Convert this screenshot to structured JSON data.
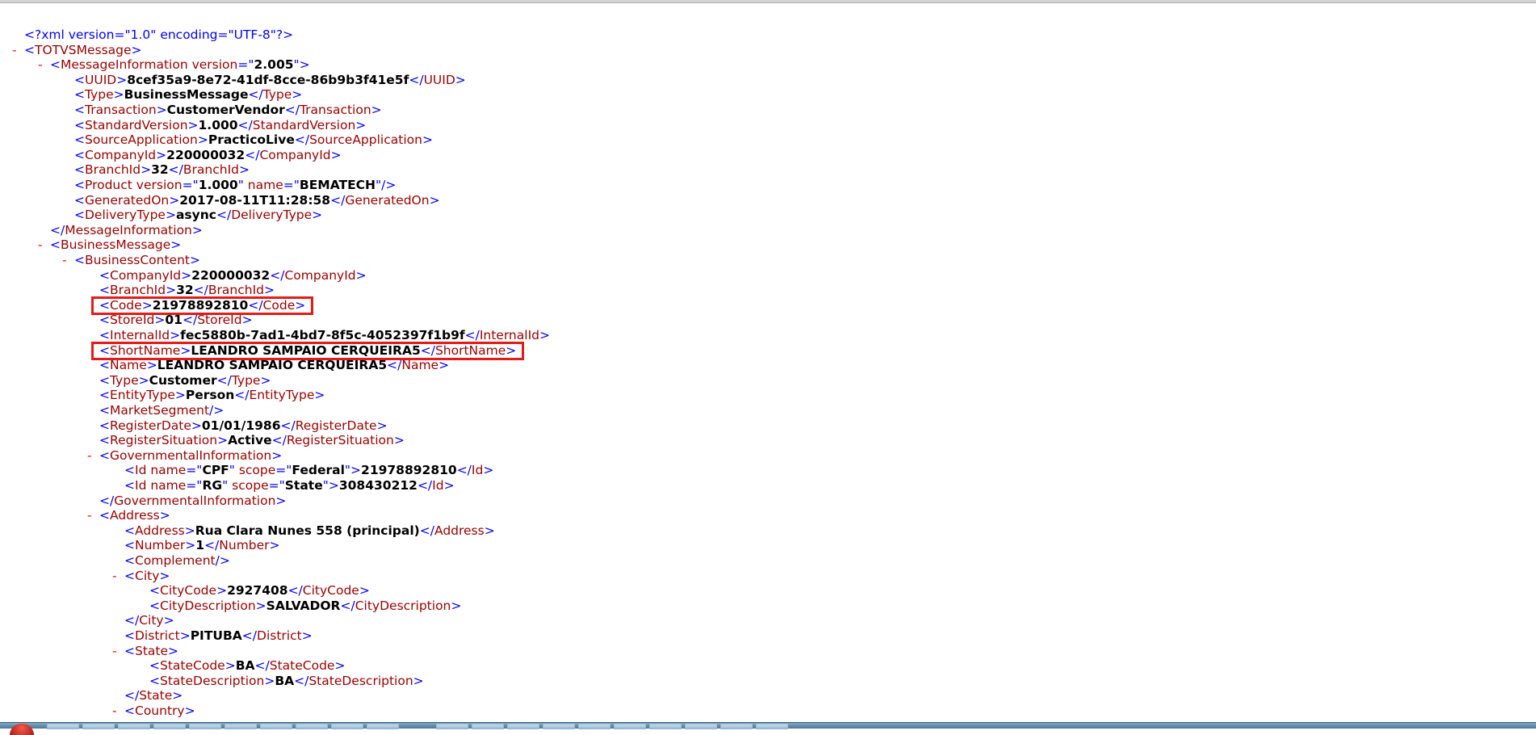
{
  "prolog": "<?xml version=\"1.0\" encoding=\"UTF-8\"?>",
  "toggle_symbol": "-",
  "xml_lines": [
    {
      "indent": 1,
      "toggle": false,
      "parts": [
        [
          "tg",
          "<?xml version=\"1.0\" encoding=\"UTF-8\"?>"
        ]
      ]
    },
    {
      "indent": 1,
      "toggle": true,
      "parts": [
        [
          "tg",
          "<"
        ],
        [
          "tn",
          "TOTVSMessage"
        ],
        [
          "tg",
          ">"
        ]
      ]
    },
    {
      "indent": 2,
      "toggle": true,
      "parts": [
        [
          "tg",
          "<"
        ],
        [
          "tn",
          "MessageInformation"
        ],
        [
          "an",
          " version"
        ],
        [
          "tg",
          "=\""
        ],
        [
          "av",
          "2.005"
        ],
        [
          "tg",
          "\">"
        ]
      ]
    },
    {
      "indent": 3,
      "toggle": false,
      "parts": [
        [
          "tg",
          "<"
        ],
        [
          "tn",
          "UUID"
        ],
        [
          "tg",
          ">"
        ],
        [
          "tx",
          "8cef35a9-8e72-41df-8cce-86b9b3f41e5f"
        ],
        [
          "tg",
          "</"
        ],
        [
          "tn",
          "UUID"
        ],
        [
          "tg",
          ">"
        ]
      ]
    },
    {
      "indent": 3,
      "toggle": false,
      "parts": [
        [
          "tg",
          "<"
        ],
        [
          "tn",
          "Type"
        ],
        [
          "tg",
          ">"
        ],
        [
          "tx",
          "BusinessMessage"
        ],
        [
          "tg",
          "</"
        ],
        [
          "tn",
          "Type"
        ],
        [
          "tg",
          ">"
        ]
      ]
    },
    {
      "indent": 3,
      "toggle": false,
      "parts": [
        [
          "tg",
          "<"
        ],
        [
          "tn",
          "Transaction"
        ],
        [
          "tg",
          ">"
        ],
        [
          "tx",
          "CustomerVendor"
        ],
        [
          "tg",
          "</"
        ],
        [
          "tn",
          "Transaction"
        ],
        [
          "tg",
          ">"
        ]
      ]
    },
    {
      "indent": 3,
      "toggle": false,
      "parts": [
        [
          "tg",
          "<"
        ],
        [
          "tn",
          "StandardVersion"
        ],
        [
          "tg",
          ">"
        ],
        [
          "tx",
          "1.000"
        ],
        [
          "tg",
          "</"
        ],
        [
          "tn",
          "StandardVersion"
        ],
        [
          "tg",
          ">"
        ]
      ]
    },
    {
      "indent": 3,
      "toggle": false,
      "parts": [
        [
          "tg",
          "<"
        ],
        [
          "tn",
          "SourceApplication"
        ],
        [
          "tg",
          ">"
        ],
        [
          "tx",
          "PracticoLive"
        ],
        [
          "tg",
          "</"
        ],
        [
          "tn",
          "SourceApplication"
        ],
        [
          "tg",
          ">"
        ]
      ]
    },
    {
      "indent": 3,
      "toggle": false,
      "parts": [
        [
          "tg",
          "<"
        ],
        [
          "tn",
          "CompanyId"
        ],
        [
          "tg",
          ">"
        ],
        [
          "tx",
          "220000032"
        ],
        [
          "tg",
          "</"
        ],
        [
          "tn",
          "CompanyId"
        ],
        [
          "tg",
          ">"
        ]
      ]
    },
    {
      "indent": 3,
      "toggle": false,
      "parts": [
        [
          "tg",
          "<"
        ],
        [
          "tn",
          "BranchId"
        ],
        [
          "tg",
          ">"
        ],
        [
          "tx",
          "32"
        ],
        [
          "tg",
          "</"
        ],
        [
          "tn",
          "BranchId"
        ],
        [
          "tg",
          ">"
        ]
      ]
    },
    {
      "indent": 3,
      "toggle": false,
      "parts": [
        [
          "tg",
          "<"
        ],
        [
          "tn",
          "Product"
        ],
        [
          "an",
          " version"
        ],
        [
          "tg",
          "=\""
        ],
        [
          "av",
          "1.000"
        ],
        [
          "tg",
          "\""
        ],
        [
          "an",
          " name"
        ],
        [
          "tg",
          "=\""
        ],
        [
          "av",
          "BEMATECH"
        ],
        [
          "tg",
          "\"/>"
        ]
      ]
    },
    {
      "indent": 3,
      "toggle": false,
      "parts": [
        [
          "tg",
          "<"
        ],
        [
          "tn",
          "GeneratedOn"
        ],
        [
          "tg",
          ">"
        ],
        [
          "tx",
          "2017-08-11T11:28:58"
        ],
        [
          "tg",
          "</"
        ],
        [
          "tn",
          "GeneratedOn"
        ],
        [
          "tg",
          ">"
        ]
      ]
    },
    {
      "indent": 3,
      "toggle": false,
      "parts": [
        [
          "tg",
          "<"
        ],
        [
          "tn",
          "DeliveryType"
        ],
        [
          "tg",
          ">"
        ],
        [
          "tx",
          "async"
        ],
        [
          "tg",
          "</"
        ],
        [
          "tn",
          "DeliveryType"
        ],
        [
          "tg",
          ">"
        ]
      ]
    },
    {
      "indent": 2,
      "toggle": false,
      "parts": [
        [
          "tg",
          "</"
        ],
        [
          "tn",
          "MessageInformation"
        ],
        [
          "tg",
          ">"
        ]
      ]
    },
    {
      "indent": 2,
      "toggle": true,
      "parts": [
        [
          "tg",
          "<"
        ],
        [
          "tn",
          "BusinessMessage"
        ],
        [
          "tg",
          ">"
        ]
      ]
    },
    {
      "indent": 3,
      "toggle": true,
      "parts": [
        [
          "tg",
          "<"
        ],
        [
          "tn",
          "BusinessContent"
        ],
        [
          "tg",
          ">"
        ]
      ]
    },
    {
      "indent": 4,
      "toggle": false,
      "parts": [
        [
          "tg",
          "<"
        ],
        [
          "tn",
          "CompanyId"
        ],
        [
          "tg",
          ">"
        ],
        [
          "tx",
          "220000032"
        ],
        [
          "tg",
          "</"
        ],
        [
          "tn",
          "CompanyId"
        ],
        [
          "tg",
          ">"
        ]
      ]
    },
    {
      "indent": 4,
      "toggle": false,
      "parts": [
        [
          "tg",
          "<"
        ],
        [
          "tn",
          "BranchId"
        ],
        [
          "tg",
          ">"
        ],
        [
          "tx",
          "32"
        ],
        [
          "tg",
          "</"
        ],
        [
          "tn",
          "BranchId"
        ],
        [
          "tg",
          ">"
        ]
      ]
    },
    {
      "indent": 4,
      "toggle": false,
      "parts": [
        [
          "tg",
          "<"
        ],
        [
          "tn",
          "Code"
        ],
        [
          "tg",
          ">"
        ],
        [
          "tx",
          "21978892810"
        ],
        [
          "tg",
          "</"
        ],
        [
          "tn",
          "Code"
        ],
        [
          "tg",
          ">"
        ]
      ]
    },
    {
      "indent": 4,
      "toggle": false,
      "parts": [
        [
          "tg",
          "<"
        ],
        [
          "tn",
          "StoreId"
        ],
        [
          "tg",
          ">"
        ],
        [
          "tx",
          "01"
        ],
        [
          "tg",
          "</"
        ],
        [
          "tn",
          "StoreId"
        ],
        [
          "tg",
          ">"
        ]
      ]
    },
    {
      "indent": 4,
      "toggle": false,
      "parts": [
        [
          "tg",
          "<"
        ],
        [
          "tn",
          "InternalId"
        ],
        [
          "tg",
          ">"
        ],
        [
          "tx",
          "fec5880b-7ad1-4bd7-8f5c-4052397f1b9f"
        ],
        [
          "tg",
          "</"
        ],
        [
          "tn",
          "InternalId"
        ],
        [
          "tg",
          ">"
        ]
      ]
    },
    {
      "indent": 4,
      "toggle": false,
      "parts": [
        [
          "tg",
          "<"
        ],
        [
          "tn",
          "ShortName"
        ],
        [
          "tg",
          ">"
        ],
        [
          "tx",
          "LEANDRO SAMPAIO CERQUEIRA5"
        ],
        [
          "tg",
          "</"
        ],
        [
          "tn",
          "ShortName"
        ],
        [
          "tg",
          ">"
        ]
      ]
    },
    {
      "indent": 4,
      "toggle": false,
      "parts": [
        [
          "tg",
          "<"
        ],
        [
          "tn",
          "Name"
        ],
        [
          "tg",
          ">"
        ],
        [
          "tx",
          "LEANDRO SAMPAIO CERQUEIRA5"
        ],
        [
          "tg",
          "</"
        ],
        [
          "tn",
          "Name"
        ],
        [
          "tg",
          ">"
        ]
      ]
    },
    {
      "indent": 4,
      "toggle": false,
      "parts": [
        [
          "tg",
          "<"
        ],
        [
          "tn",
          "Type"
        ],
        [
          "tg",
          ">"
        ],
        [
          "tx",
          "Customer"
        ],
        [
          "tg",
          "</"
        ],
        [
          "tn",
          "Type"
        ],
        [
          "tg",
          ">"
        ]
      ]
    },
    {
      "indent": 4,
      "toggle": false,
      "parts": [
        [
          "tg",
          "<"
        ],
        [
          "tn",
          "EntityType"
        ],
        [
          "tg",
          ">"
        ],
        [
          "tx",
          "Person"
        ],
        [
          "tg",
          "</"
        ],
        [
          "tn",
          "EntityType"
        ],
        [
          "tg",
          ">"
        ]
      ]
    },
    {
      "indent": 4,
      "toggle": false,
      "parts": [
        [
          "tg",
          "<"
        ],
        [
          "tn",
          "MarketSegment"
        ],
        [
          "tg",
          "/>"
        ]
      ]
    },
    {
      "indent": 4,
      "toggle": false,
      "parts": [
        [
          "tg",
          "<"
        ],
        [
          "tn",
          "RegisterDate"
        ],
        [
          "tg",
          ">"
        ],
        [
          "tx",
          "01/01/1986"
        ],
        [
          "tg",
          "</"
        ],
        [
          "tn",
          "RegisterDate"
        ],
        [
          "tg",
          ">"
        ]
      ]
    },
    {
      "indent": 4,
      "toggle": false,
      "parts": [
        [
          "tg",
          "<"
        ],
        [
          "tn",
          "RegisterSituation"
        ],
        [
          "tg",
          ">"
        ],
        [
          "tx",
          "Active"
        ],
        [
          "tg",
          "</"
        ],
        [
          "tn",
          "RegisterSituation"
        ],
        [
          "tg",
          ">"
        ]
      ]
    },
    {
      "indent": 4,
      "toggle": true,
      "parts": [
        [
          "tg",
          "<"
        ],
        [
          "tn",
          "GovernmentalInformation"
        ],
        [
          "tg",
          ">"
        ]
      ]
    },
    {
      "indent": 5,
      "toggle": false,
      "parts": [
        [
          "tg",
          "<"
        ],
        [
          "tn",
          "Id"
        ],
        [
          "an",
          " name"
        ],
        [
          "tg",
          "=\""
        ],
        [
          "av",
          "CPF"
        ],
        [
          "tg",
          "\""
        ],
        [
          "an",
          " scope"
        ],
        [
          "tg",
          "=\""
        ],
        [
          "av",
          "Federal"
        ],
        [
          "tg",
          "\">"
        ],
        [
          "tx",
          "21978892810"
        ],
        [
          "tg",
          "</"
        ],
        [
          "tn",
          "Id"
        ],
        [
          "tg",
          ">"
        ]
      ]
    },
    {
      "indent": 5,
      "toggle": false,
      "parts": [
        [
          "tg",
          "<"
        ],
        [
          "tn",
          "Id"
        ],
        [
          "an",
          " name"
        ],
        [
          "tg",
          "=\""
        ],
        [
          "av",
          "RG"
        ],
        [
          "tg",
          "\""
        ],
        [
          "an",
          " scope"
        ],
        [
          "tg",
          "=\""
        ],
        [
          "av",
          "State"
        ],
        [
          "tg",
          "\">"
        ],
        [
          "tx",
          "308430212"
        ],
        [
          "tg",
          "</"
        ],
        [
          "tn",
          "Id"
        ],
        [
          "tg",
          ">"
        ]
      ]
    },
    {
      "indent": 4,
      "toggle": false,
      "parts": [
        [
          "tg",
          "</"
        ],
        [
          "tn",
          "GovernmentalInformation"
        ],
        [
          "tg",
          ">"
        ]
      ]
    },
    {
      "indent": 4,
      "toggle": true,
      "parts": [
        [
          "tg",
          "<"
        ],
        [
          "tn",
          "Address"
        ],
        [
          "tg",
          ">"
        ]
      ]
    },
    {
      "indent": 5,
      "toggle": false,
      "parts": [
        [
          "tg",
          "<"
        ],
        [
          "tn",
          "Address"
        ],
        [
          "tg",
          ">"
        ],
        [
          "tx",
          "Rua Clara Nunes 558 (principal)"
        ],
        [
          "tg",
          "</"
        ],
        [
          "tn",
          "Address"
        ],
        [
          "tg",
          ">"
        ]
      ]
    },
    {
      "indent": 5,
      "toggle": false,
      "parts": [
        [
          "tg",
          "<"
        ],
        [
          "tn",
          "Number"
        ],
        [
          "tg",
          ">"
        ],
        [
          "tx",
          "1"
        ],
        [
          "tg",
          "</"
        ],
        [
          "tn",
          "Number"
        ],
        [
          "tg",
          ">"
        ]
      ]
    },
    {
      "indent": 5,
      "toggle": false,
      "parts": [
        [
          "tg",
          "<"
        ],
        [
          "tn",
          "Complement"
        ],
        [
          "tg",
          "/>"
        ]
      ]
    },
    {
      "indent": 5,
      "toggle": true,
      "parts": [
        [
          "tg",
          "<"
        ],
        [
          "tn",
          "City"
        ],
        [
          "tg",
          ">"
        ]
      ]
    },
    {
      "indent": 6,
      "toggle": false,
      "parts": [
        [
          "tg",
          "<"
        ],
        [
          "tn",
          "CityCode"
        ],
        [
          "tg",
          ">"
        ],
        [
          "tx",
          "2927408"
        ],
        [
          "tg",
          "</"
        ],
        [
          "tn",
          "CityCode"
        ],
        [
          "tg",
          ">"
        ]
      ]
    },
    {
      "indent": 6,
      "toggle": false,
      "parts": [
        [
          "tg",
          "<"
        ],
        [
          "tn",
          "CityDescription"
        ],
        [
          "tg",
          ">"
        ],
        [
          "tx",
          "SALVADOR"
        ],
        [
          "tg",
          "</"
        ],
        [
          "tn",
          "CityDescription"
        ],
        [
          "tg",
          ">"
        ]
      ]
    },
    {
      "indent": 5,
      "toggle": false,
      "parts": [
        [
          "tg",
          "</"
        ],
        [
          "tn",
          "City"
        ],
        [
          "tg",
          ">"
        ]
      ]
    },
    {
      "indent": 5,
      "toggle": false,
      "parts": [
        [
          "tg",
          "<"
        ],
        [
          "tn",
          "District"
        ],
        [
          "tg",
          ">"
        ],
        [
          "tx",
          "PITUBA"
        ],
        [
          "tg",
          "</"
        ],
        [
          "tn",
          "District"
        ],
        [
          "tg",
          ">"
        ]
      ]
    },
    {
      "indent": 5,
      "toggle": true,
      "parts": [
        [
          "tg",
          "<"
        ],
        [
          "tn",
          "State"
        ],
        [
          "tg",
          ">"
        ]
      ]
    },
    {
      "indent": 6,
      "toggle": false,
      "parts": [
        [
          "tg",
          "<"
        ],
        [
          "tn",
          "StateCode"
        ],
        [
          "tg",
          ">"
        ],
        [
          "tx",
          "BA"
        ],
        [
          "tg",
          "</"
        ],
        [
          "tn",
          "StateCode"
        ],
        [
          "tg",
          ">"
        ]
      ]
    },
    {
      "indent": 6,
      "toggle": false,
      "parts": [
        [
          "tg",
          "<"
        ],
        [
          "tn",
          "StateDescription"
        ],
        [
          "tg",
          ">"
        ],
        [
          "tx",
          "BA"
        ],
        [
          "tg",
          "</"
        ],
        [
          "tn",
          "StateDescription"
        ],
        [
          "tg",
          ">"
        ]
      ]
    },
    {
      "indent": 5,
      "toggle": false,
      "parts": [
        [
          "tg",
          "</"
        ],
        [
          "tn",
          "State"
        ],
        [
          "tg",
          ">"
        ]
      ]
    },
    {
      "indent": 5,
      "toggle": true,
      "parts": [
        [
          "tg",
          "<"
        ],
        [
          "tn",
          "Country"
        ],
        [
          "tg",
          ">"
        ]
      ]
    }
  ],
  "highlighted_lines": [
    18,
    21
  ],
  "colors": {
    "tag_bracket": "#0000ff",
    "tag_name": "#990000",
    "text_value": "#000000",
    "toggle": "#ff0000",
    "highlight_box": "#e31b1b"
  }
}
